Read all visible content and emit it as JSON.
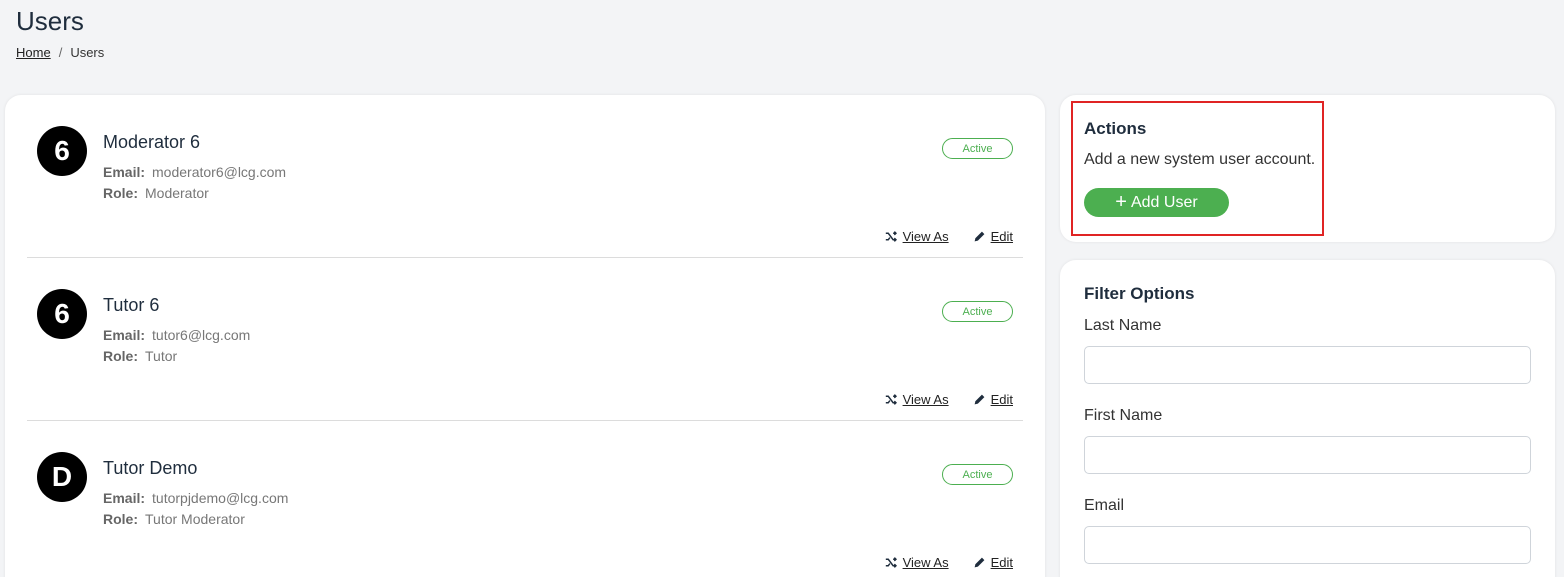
{
  "header": {
    "title": "Users",
    "breadcrumb": {
      "home": "Home",
      "separator": "/",
      "current": "Users"
    }
  },
  "users": [
    {
      "avatar": "6",
      "name": "Moderator 6",
      "email_label": "Email:",
      "email": "moderator6@lcg.com",
      "role_label": "Role:",
      "role": "Moderator",
      "status": "Active",
      "view_as": "View As",
      "edit": "Edit"
    },
    {
      "avatar": "6",
      "name": "Tutor 6",
      "email_label": "Email:",
      "email": "tutor6@lcg.com",
      "role_label": "Role:",
      "role": "Tutor",
      "status": "Active",
      "view_as": "View As",
      "edit": "Edit"
    },
    {
      "avatar": "D",
      "name": "Tutor Demo",
      "email_label": "Email:",
      "email": "tutorpjdemo@lcg.com",
      "role_label": "Role:",
      "role": "Tutor Moderator",
      "status": "Active",
      "view_as": "View As",
      "edit": "Edit"
    }
  ],
  "actions": {
    "title": "Actions",
    "description": "Add a new system user account.",
    "add_user_label": "Add User",
    "add_user_icon": "plus-icon"
  },
  "filters": {
    "title": "Filter Options",
    "last_name_label": "Last Name",
    "last_name_value": "",
    "first_name_label": "First Name",
    "first_name_value": "",
    "email_label": "Email",
    "email_value": ""
  },
  "colors": {
    "accent_green": "#4caf50",
    "highlight_red": "#e02424",
    "avatar_bg": "#000000"
  }
}
